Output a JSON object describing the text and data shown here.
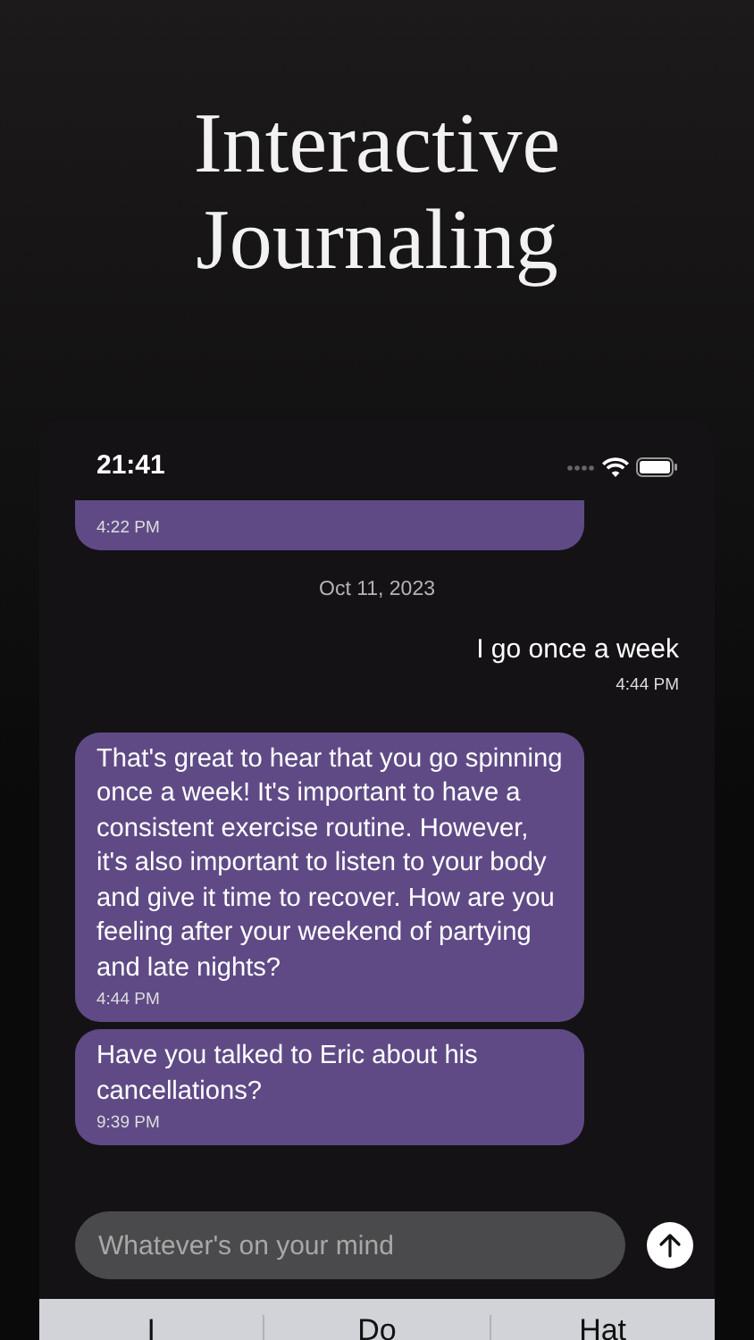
{
  "headline": "Interactive Journaling",
  "status_bar": {
    "time": "21:41"
  },
  "messages": [
    {
      "kind": "bot",
      "time": "4:22 PM"
    },
    {
      "kind": "date",
      "text": "Oct 11, 2023"
    },
    {
      "kind": "user",
      "text": "I go once a week",
      "time": "4:44 PM"
    },
    {
      "kind": "bot",
      "text": "That's great to hear that you go spinning once a week! It's important to have a consistent exercise routine. However, it's also important to listen to your body and give it time to recover. How are you feeling after your weekend of partying and late nights?",
      "time": "4:44 PM"
    },
    {
      "kind": "bot",
      "text": "Have you talked to Eric about his cancellations?",
      "time": "9:39 PM"
    }
  ],
  "composer": {
    "placeholder": "Whatever's on your mind"
  },
  "suggestions": [
    "I",
    "Do",
    "Hat"
  ]
}
